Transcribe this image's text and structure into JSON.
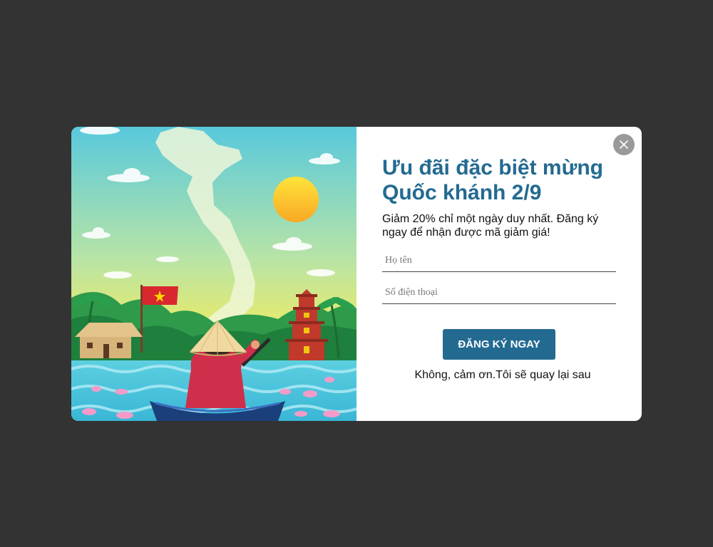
{
  "popup": {
    "title": "Ưu đãi đặc biệt mừng Quốc khánh 2/9",
    "description": "Giảm 20% chỉ một ngày duy nhất. Đăng ký ngay để nhận được mã giảm giá!",
    "name_placeholder": "Họ tên",
    "phone_placeholder": "Số điện thoại",
    "submit_label": "ĐĂNG KÝ NGAY",
    "decline_label": "Không, cảm ơn.Tôi sẽ quay lại sau",
    "close_icon": "close-icon",
    "colors": {
      "accent": "#236A91",
      "backdrop": "#333333",
      "close_button": "#9a9a9a"
    }
  }
}
